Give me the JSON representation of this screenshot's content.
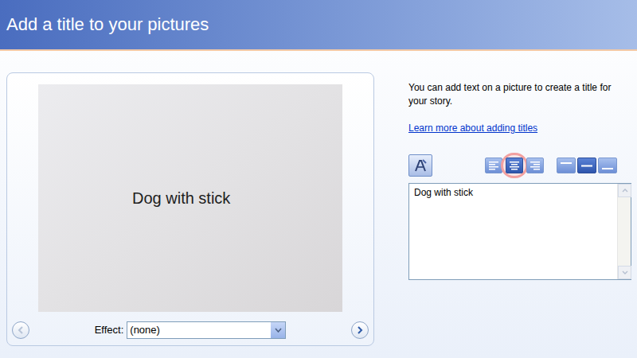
{
  "header": {
    "title": "Add a title to your pictures"
  },
  "preview": {
    "title_overlay": "Dog with stick"
  },
  "effect": {
    "label": "Effect:",
    "value": "(none)"
  },
  "help": {
    "text": "You can add text on a picture to create a title for your story.",
    "link": "Learn more about adding titles"
  },
  "toolbar": {
    "horizontal_align": [
      {
        "kind": "left",
        "selected": false,
        "highlighted": false
      },
      {
        "kind": "center",
        "selected": true,
        "highlighted": true
      },
      {
        "kind": "right",
        "selected": false,
        "highlighted": false
      }
    ],
    "vertical_align": [
      {
        "kind": "top",
        "selected": false
      },
      {
        "kind": "middle",
        "selected": true
      },
      {
        "kind": "bottom",
        "selected": false
      }
    ]
  },
  "title_text": "Dog with stick"
}
